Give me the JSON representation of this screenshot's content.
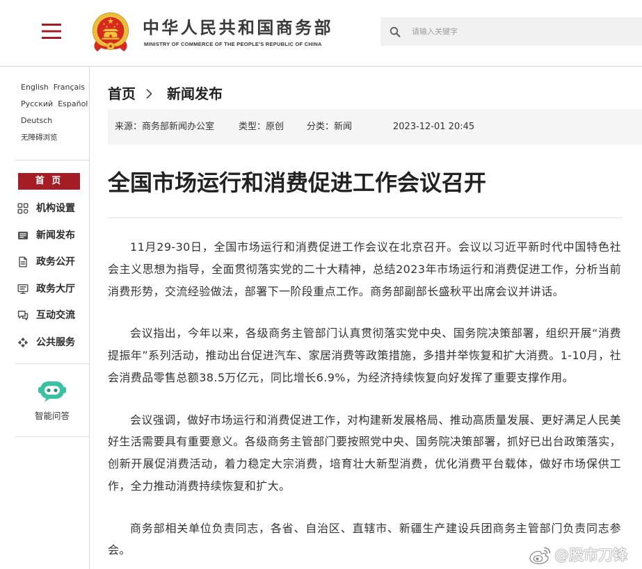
{
  "header": {
    "menu_icon": "hamburger-menu-icon",
    "emblem_icon": "national-emblem-icon",
    "title": "中华人民共和国商务部",
    "subtitle": "MINISTRY OF COMMERCE OF THE PEOPLE'S REPUBLIC OF CHINA",
    "search": {
      "placeholder": "请输入关键字",
      "icon": "search-icon"
    }
  },
  "sidebar": {
    "languages": [
      "English",
      "Français",
      "Русский",
      "Español",
      "Deutsch"
    ],
    "accessibility": "无障碍浏览",
    "home": "首 页",
    "nav": [
      {
        "label": "机构设置",
        "icon": "org-structure-icon"
      },
      {
        "label": "新闻发布",
        "icon": "news-icon"
      },
      {
        "label": "政务公开",
        "icon": "document-icon"
      },
      {
        "label": "政务大厅",
        "icon": "service-hall-icon"
      },
      {
        "label": "互动交流",
        "icon": "chat-icon"
      },
      {
        "label": "公共服务",
        "icon": "public-service-icon"
      }
    ],
    "assistant": {
      "label": "智能问答",
      "icon": "chatbot-icon"
    }
  },
  "breadcrumb": {
    "items": [
      "首页",
      "新闻发布"
    ],
    "separator_icon": "chevron-right-icon"
  },
  "article": {
    "meta": {
      "source": "来源：商务部新闻办公室",
      "type": "类型：原创",
      "category": "分类：新闻",
      "datetime": "2023-12-01 20:45"
    },
    "title": "全国市场运行和消费促进工作会议召开",
    "paragraphs": [
      "11月29-30日，全国市场运行和消费促进工作会议在北京召开。会议以习近平新时代中国特色社会主义思想为指导，全面贯彻落实党的二十大精神，总结2023年市场运行和消费促进工作，分析当前消费形势，交流经验做法，部署下一阶段重点工作。商务部副部长盛秋平出席会议并讲话。",
      "会议指出，今年以来，各级商务主管部门认真贯彻落实党中央、国务院决策部署，组织开展“消费提振年”系列活动，推动出台促进汽车、家居消费等政策措施，多措并举恢复和扩大消费。1-10月，社会消费品零售总额38.5万亿元，同比增长6.9%，为经济持续恢复向好发挥了重要支撑作用。",
      "会议强调，做好市场运行和消费促进工作，对构建新发展格局、推动高质量发展、更好满足人民美好生活需要具有重要意义。各级商务主管部门要按照党中央、国务院决策部署，抓好已出台政策落实，创新开展促消费活动，着力稳定大宗消费，培育壮大新型消费，优化消费平台载体，做好市场保供工作，全力推动消费持续恢复和扩大。",
      "商务部相关单位负责同志，各省、自治区、直辖市、新疆生产建设兵团商务主管部门负责同志参会。"
    ]
  },
  "watermark": {
    "text": "@股市刀锋",
    "icon": "weibo-icon"
  },
  "colors": {
    "brand_red": "#a51d24",
    "emblem_red": "#d62a1e",
    "emblem_gold": "#efc43d",
    "assistant_teal": "#3ac1a4",
    "meta_bar": "#f5f5f5",
    "search_bg": "#f1f1f1"
  }
}
